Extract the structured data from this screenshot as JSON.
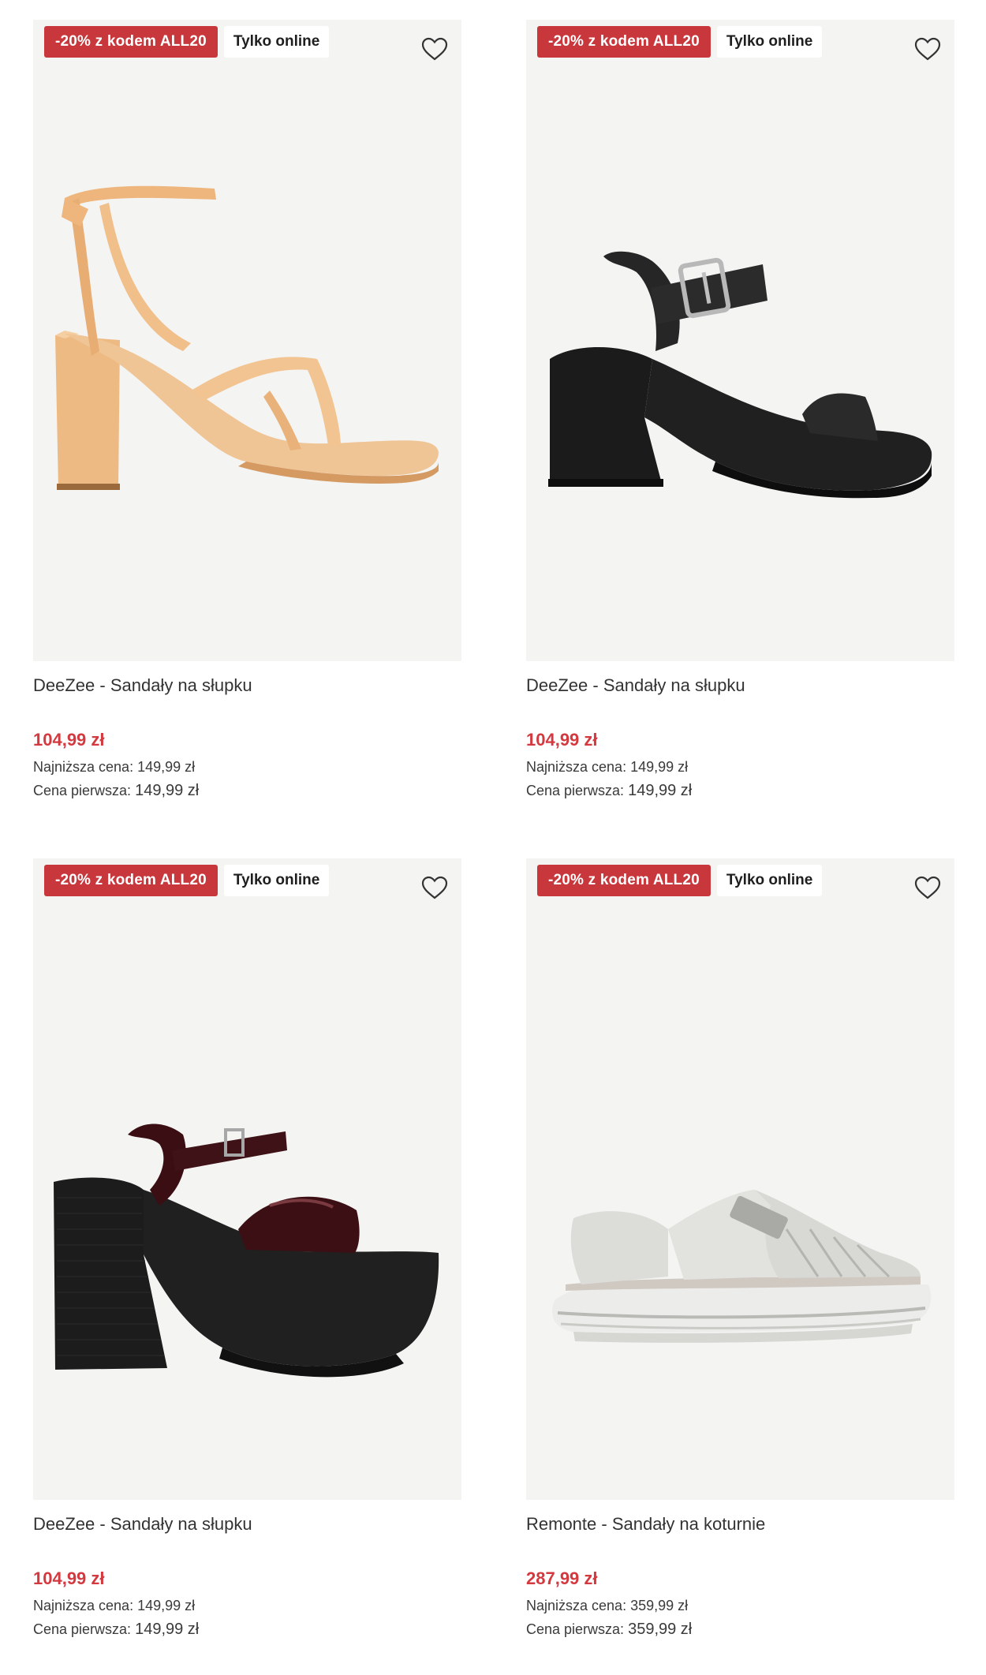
{
  "products": [
    {
      "promo_badge": "-20% z kodem ALL20",
      "online_badge": "Tylko online",
      "title": "DeeZee - Sandały na słupku",
      "price": "104,99 zł",
      "lowest_label": "Najniższa cena:",
      "lowest_value": "149,99 zł",
      "first_label": "Cena pierwsza:",
      "first_value": "149,99 zł",
      "image_icon": "beige-lace-up-heel-sandal",
      "shoe_color": "#f0c596"
    },
    {
      "promo_badge": "-20% z kodem ALL20",
      "online_badge": "Tylko online",
      "title": "DeeZee - Sandały na słupku",
      "price": "104,99 zł",
      "lowest_label": "Najniższa cena:",
      "lowest_value": "149,99 zł",
      "first_label": "Cena pierwsza:",
      "first_value": "149,99 zł",
      "image_icon": "black-platform-buckle-sandal",
      "shoe_color": "#1c1c1c"
    },
    {
      "promo_badge": "-20% z kodem ALL20",
      "online_badge": "Tylko online",
      "title": "DeeZee - Sandały na słupku",
      "price": "104,99 zł",
      "lowest_label": "Najniższa cena:",
      "lowest_value": "149,99 zł",
      "first_label": "Cena pierwsza:",
      "first_value": "149,99 zł",
      "image_icon": "burgundy-patent-platform-sandal",
      "shoe_color": "#3b0f14"
    },
    {
      "promo_badge": "-20% z kodem ALL20",
      "online_badge": "Tylko online",
      "title": "Remonte - Sandały na koturnie",
      "price": "287,99 zł",
      "lowest_label": "Najniższa cena:",
      "lowest_value": "359,99 zł",
      "first_label": "Cena pierwsza:",
      "first_value": "359,99 zł",
      "image_icon": "silver-wedge-sandal",
      "shoe_color": "#d9d9d6"
    }
  ],
  "colors": {
    "promo_badge_bg": "#c8373c",
    "price": "#d3393f",
    "image_bg": "#f4f4f3"
  },
  "icons": {
    "wishlist": "heart-outline-icon"
  }
}
